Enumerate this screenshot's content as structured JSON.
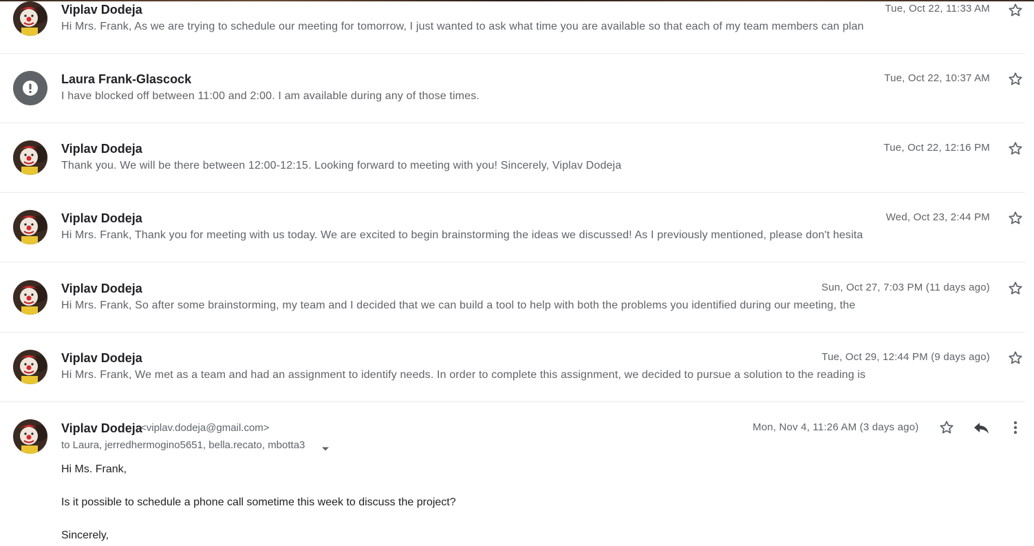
{
  "messages": [
    {
      "sender": "Viplav Dodeja",
      "snippet": "Hi Mrs. Frank, As we are trying to schedule our meeting for tomorrow, I just wanted to ask what time you are available so that each of my team members can plan",
      "date": "Tue, Oct 22, 11:33 AM",
      "avatar": "photo"
    },
    {
      "sender": "Laura Frank-Glascock",
      "snippet": "I have blocked off between 11:00 and 2:00. I am available during any of those times.",
      "date": "Tue, Oct 22, 10:37 AM",
      "avatar": "warning-icon"
    },
    {
      "sender": "Viplav Dodeja",
      "snippet": "Thank you. We will be there between 12:00-12:15. Looking forward to meeting with you! Sincerely, Viplav Dodeja",
      "date": "Tue, Oct 22, 12:16 PM",
      "avatar": "photo"
    },
    {
      "sender": "Viplav Dodeja",
      "snippet": "Hi Mrs. Frank, Thank you for meeting with us today. We are excited to begin brainstorming the ideas we discussed! As I previously mentioned, please don't hesita",
      "date": "Wed, Oct 23, 2:44 PM",
      "avatar": "photo"
    },
    {
      "sender": "Viplav Dodeja",
      "snippet": "Hi Mrs. Frank, So after some brainstorming, my team and I decided that we can build a tool to help with both the problems you identified during our meeting, the",
      "date": "Sun, Oct 27, 7:03 PM (11 days ago)",
      "avatar": "photo"
    },
    {
      "sender": "Viplav Dodeja",
      "snippet": "Hi Mrs. Frank, We met as a team and had an assignment to identify needs. In order to complete this assignment, we decided to pursue a solution to the reading is",
      "date": "Tue, Oct 29, 12:44 PM (9 days ago)",
      "avatar": "photo"
    }
  ],
  "expanded": {
    "sender": "Viplav Dodeja",
    "email": "<viplav.dodeja@gmail.com>",
    "to": "to Laura, jerredhermogino5651, bella.recato, mbotta3",
    "date": "Mon, Nov 4, 11:26 AM (3 days ago)",
    "body": [
      "Hi Ms. Frank,",
      "Is it possible to schedule a phone call sometime this week to discuss the project?",
      "Sincerely,"
    ]
  },
  "icons": {
    "star": "star-outline-icon",
    "reply": "reply-icon",
    "more": "more-vert-icon",
    "caret": "caret-down-icon"
  },
  "colors": {
    "text": "#202124",
    "secondary": "#5f6368",
    "divider": "#e8eaed",
    "warning_avatar": "#5f6368"
  }
}
